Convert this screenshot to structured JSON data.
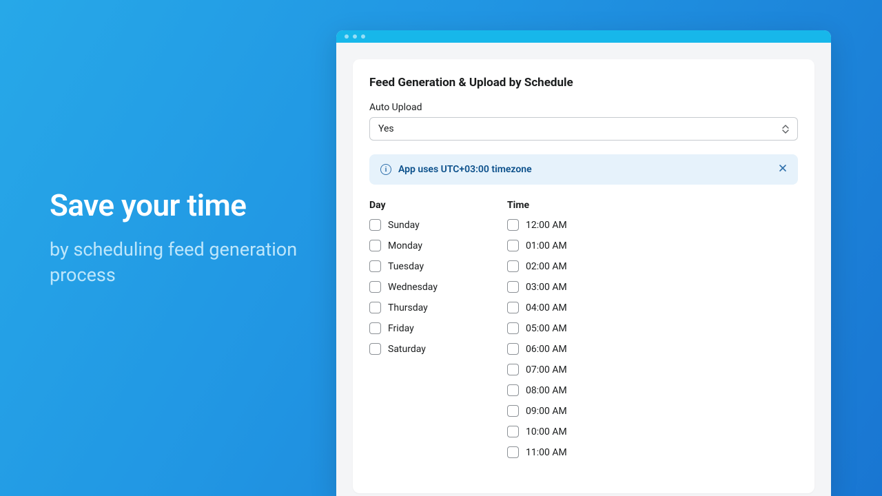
{
  "promo": {
    "headline": "Save your time",
    "subline": "by scheduling feed generation process"
  },
  "card": {
    "title": "Feed Generation & Upload by Schedule",
    "auto_upload_label": "Auto Upload",
    "auto_upload_value": "Yes",
    "banner_text": "App uses UTC+03:00 timezone",
    "day_header": "Day",
    "time_header": "Time"
  },
  "days": [
    {
      "label": "Sunday"
    },
    {
      "label": "Monday"
    },
    {
      "label": "Tuesday"
    },
    {
      "label": "Wednesday"
    },
    {
      "label": "Thursday"
    },
    {
      "label": "Friday"
    },
    {
      "label": "Saturday"
    }
  ],
  "times": [
    {
      "label": "12:00 AM"
    },
    {
      "label": "01:00 AM"
    },
    {
      "label": "02:00 AM"
    },
    {
      "label": "03:00 AM"
    },
    {
      "label": "04:00 AM"
    },
    {
      "label": "05:00 AM"
    },
    {
      "label": "06:00 AM"
    },
    {
      "label": "07:00 AM"
    },
    {
      "label": "08:00 AM"
    },
    {
      "label": "09:00 AM"
    },
    {
      "label": "10:00 AM"
    },
    {
      "label": "11:00 AM"
    }
  ]
}
